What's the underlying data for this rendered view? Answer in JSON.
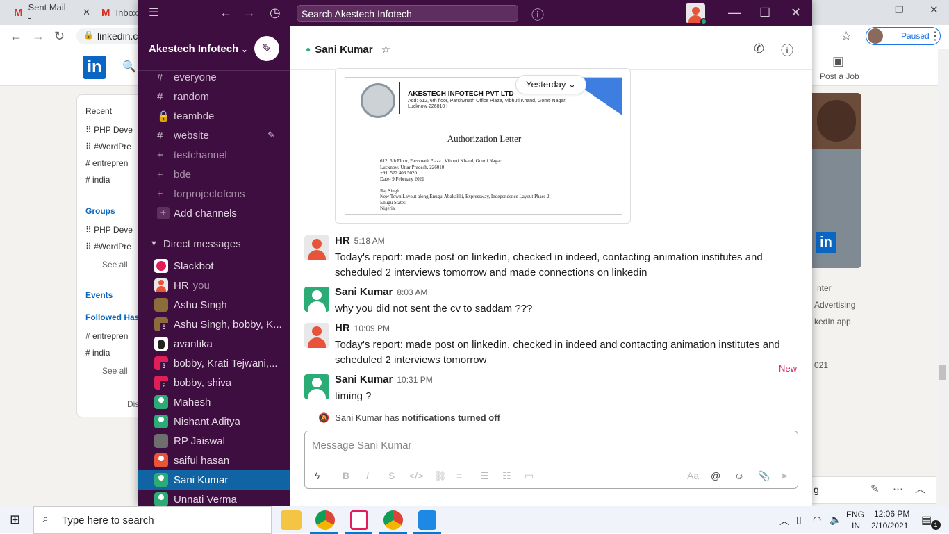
{
  "browser": {
    "tabs": [
      {
        "label": "Sent Mail -"
      },
      {
        "label": "Inbox"
      }
    ],
    "url": "linkedin.c",
    "profile_status": "Paused"
  },
  "linkedin": {
    "logo": "in",
    "post_job": "Post a Job",
    "left": {
      "recent": "Recent",
      "items": [
        "PHP Deve",
        "#WordPre",
        "entrepren",
        "india"
      ],
      "groups": "Groups",
      "group_items": [
        "PHP Deve",
        "#WordPre"
      ],
      "see_all": "See all",
      "events": "Events",
      "followed": "Followed Hash",
      "hash_items": [
        "entrepren",
        "india"
      ],
      "see_all2": "See all",
      "discover": "Disc"
    },
    "right": {
      "badge": "in",
      "t1": "nter",
      "t2": "Advertising",
      "t3": "kedIn app",
      "t4": "021",
      "t5": "g"
    }
  },
  "slack": {
    "search_placeholder": "Search Akestech Infotech",
    "workspace": "Akestech Infotech",
    "channels": [
      {
        "icon": "#",
        "name": "everyone"
      },
      {
        "icon": "#",
        "name": "random"
      },
      {
        "icon": "lock",
        "name": "teambde"
      },
      {
        "icon": "#",
        "name": "website"
      },
      {
        "icon": "+",
        "name": "testchannel"
      },
      {
        "icon": "+",
        "name": "bde"
      },
      {
        "icon": "+",
        "name": "forprojectofcms"
      }
    ],
    "add_channels": "Add channels",
    "direct_messages": "Direct messages",
    "dms": [
      {
        "name": "Slackbot"
      },
      {
        "name": "HR",
        "suffix": "you"
      },
      {
        "name": "Ashu Singh"
      },
      {
        "name": "Ashu Singh, bobby, K...",
        "count": "6"
      },
      {
        "name": "avantika"
      },
      {
        "name": "bobby, Krati Tejwani,...",
        "count": "3"
      },
      {
        "name": "bobby, shiva",
        "count": "2"
      },
      {
        "name": "Mahesh"
      },
      {
        "name": "Nishant Aditya"
      },
      {
        "name": "RP Jaiswal"
      },
      {
        "name": "saiful hasan"
      },
      {
        "name": "Sani Kumar"
      },
      {
        "name": "Unnati Verma"
      }
    ],
    "conversation": {
      "title": "Sani Kumar",
      "date_divider": "Yesterday",
      "letter": {
        "company": "AKESTECH INFOTECH PVT LTD",
        "address": "Add: 612, 6th floor, Parshvnath Office Plaza, Vibhuti Khand, Gomti Nagar,",
        "city": "Lucknow-226010 |",
        "heading": "Authorization Letter",
        "lines": [
          "612, 6th Floor, Parsvnath Plaza , Vibhuti Khand, Gomti Nagar",
          "Lucknow, Uttar Pradesh, 226010",
          "+91  522 403 5020",
          "Date- 9 February 2021",
          "",
          "Raj Singh",
          "New Town Layout along Enugu-Abakaliki, Expressway, Independence Layout Phase 2,",
          "Enugu States",
          "Nigeria"
        ]
      },
      "messages": [
        {
          "author": "HR",
          "time": "5:18 AM",
          "text": "Today's report: made post on linkedin, checked in indeed, contacting animation institutes and scheduled 2 interviews tomorrow and made connections on linkedin"
        },
        {
          "author": "Sani Kumar",
          "time": "8:03 AM",
          "text": "why you did not sent the cv to saddam ???"
        },
        {
          "author": "HR",
          "time": "10:09 PM",
          "text": "Today's report: made post on linkedin, checked in indeed and contacting animation institutes and scheduled 2 interviews tomorrow"
        },
        {
          "author": "Sani Kumar",
          "time": "10:31 PM",
          "text": "timing ?"
        }
      ],
      "new_label": "New",
      "notif_name": "Sani Kumar has",
      "notif_bold": "notifications turned off",
      "composer_placeholder": "Message Sani Kumar"
    }
  },
  "taskbar": {
    "search_placeholder": "Type here to search",
    "lang1": "ENG",
    "lang2": "IN",
    "time": "12:06 PM",
    "date": "2/10/2021",
    "notif_count": "1"
  }
}
